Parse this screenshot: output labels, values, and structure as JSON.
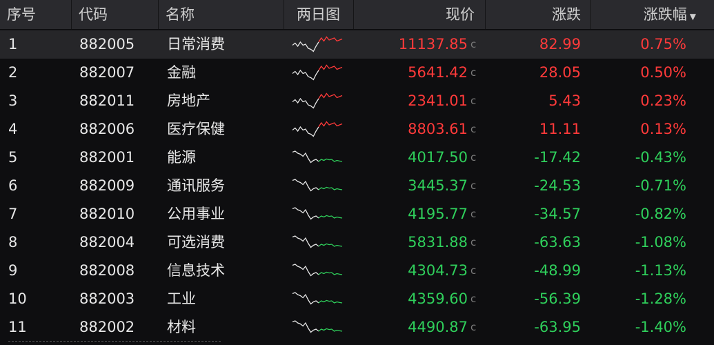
{
  "header": {
    "seq": "序号",
    "code": "代码",
    "name": "名称",
    "spark": "两日图",
    "price": "现价",
    "change": "涨跌",
    "pct": "涨跌幅"
  },
  "colors": {
    "up": "#ff3a3a",
    "down": "#2fcf5b",
    "spark_white": "#e6e6e6"
  },
  "rows": [
    {
      "seq": "1",
      "code": "882005",
      "name": "日常消费",
      "price": "11137.85",
      "unit": "c",
      "change": "82.99",
      "pct": "0.75%",
      "dir": "up"
    },
    {
      "seq": "2",
      "code": "882007",
      "name": "金融",
      "price": "5641.42",
      "unit": "c",
      "change": "28.05",
      "pct": "0.50%",
      "dir": "up"
    },
    {
      "seq": "3",
      "code": "882011",
      "name": "房地产",
      "price": "2341.01",
      "unit": "c",
      "change": "5.43",
      "pct": "0.23%",
      "dir": "up"
    },
    {
      "seq": "4",
      "code": "882006",
      "name": "医疗保健",
      "price": "8803.61",
      "unit": "c",
      "change": "11.11",
      "pct": "0.13%",
      "dir": "up"
    },
    {
      "seq": "5",
      "code": "882001",
      "name": "能源",
      "price": "4017.50",
      "unit": "c",
      "change": "-17.42",
      "pct": "-0.43%",
      "dir": "down"
    },
    {
      "seq": "6",
      "code": "882009",
      "name": "通讯服务",
      "price": "3445.37",
      "unit": "c",
      "change": "-24.53",
      "pct": "-0.71%",
      "dir": "down"
    },
    {
      "seq": "7",
      "code": "882010",
      "name": "公用事业",
      "price": "4195.77",
      "unit": "c",
      "change": "-34.57",
      "pct": "-0.82%",
      "dir": "down"
    },
    {
      "seq": "8",
      "code": "882004",
      "name": "可选消费",
      "price": "5831.88",
      "unit": "c",
      "change": "-63.63",
      "pct": "-1.08%",
      "dir": "down"
    },
    {
      "seq": "9",
      "code": "882008",
      "name": "信息技术",
      "price": "4304.73",
      "unit": "c",
      "change": "-48.99",
      "pct": "-1.13%",
      "dir": "down"
    },
    {
      "seq": "10",
      "code": "882003",
      "name": "工业",
      "price": "4359.60",
      "unit": "c",
      "change": "-56.39",
      "pct": "-1.28%",
      "dir": "down"
    },
    {
      "seq": "11",
      "code": "882002",
      "name": "材料",
      "price": "4490.87",
      "unit": "c",
      "change": "-63.95",
      "pct": "-1.40%",
      "dir": "down"
    }
  ]
}
